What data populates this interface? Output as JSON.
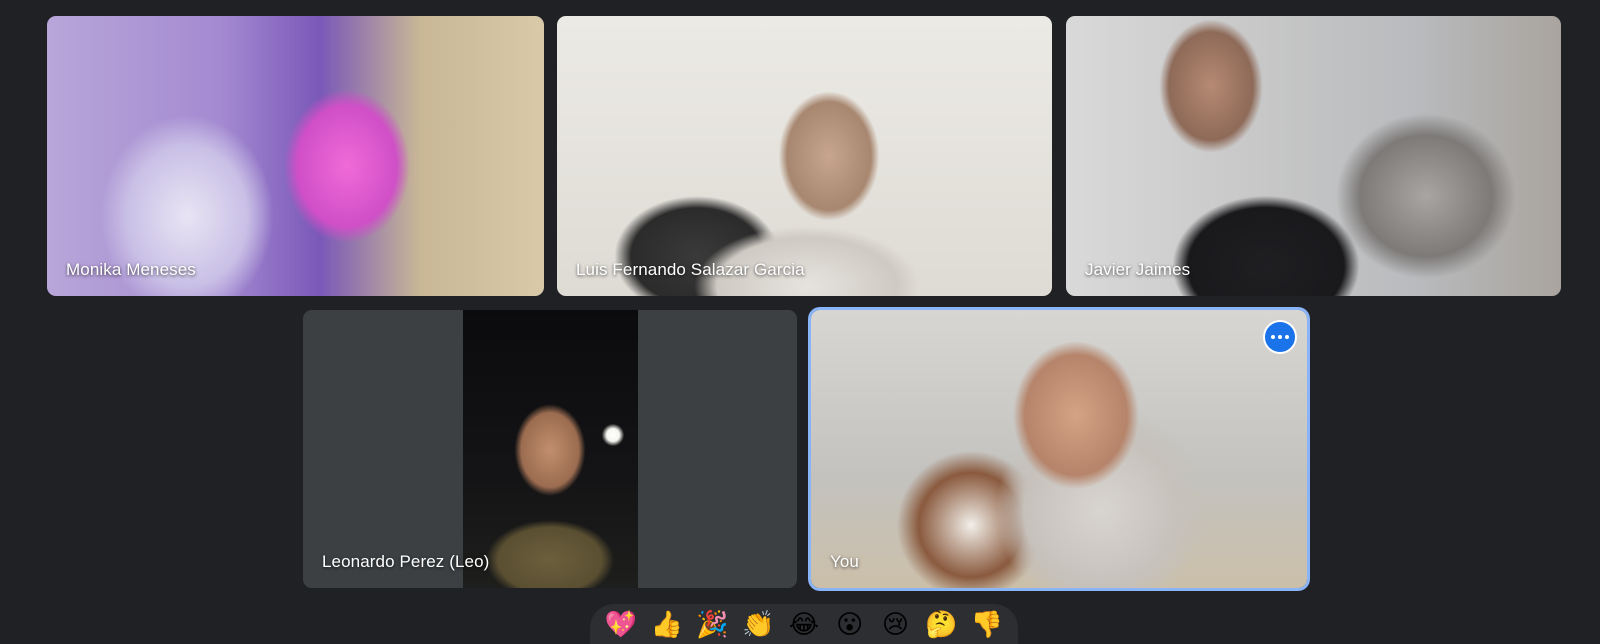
{
  "participants": [
    {
      "name": "Monika Meneses"
    },
    {
      "name": "Luis Fernando Salazar Garcia"
    },
    {
      "name": "Javier Jaimes"
    },
    {
      "name": "Leonardo Perez (Leo)"
    },
    {
      "name": "You",
      "active_speaker": true,
      "highlight_color": "#8ab4f8",
      "more_button_color": "#1a73e8"
    }
  ],
  "reactions": [
    {
      "emoji": "💖",
      "icon": "sparkling-heart-icon"
    },
    {
      "emoji": "👍",
      "icon": "thumbs-up-icon"
    },
    {
      "emoji": "🎉",
      "icon": "party-popper-icon"
    },
    {
      "emoji": "👏",
      "icon": "clapping-hands-icon"
    },
    {
      "emoji": "😂",
      "icon": "tears-of-joy-icon"
    },
    {
      "emoji": "😮",
      "icon": "surprised-face-icon"
    },
    {
      "emoji": "😢",
      "icon": "crying-face-icon"
    },
    {
      "emoji": "🤔",
      "icon": "thinking-face-icon"
    },
    {
      "emoji": "👎",
      "icon": "thumbs-down-icon"
    }
  ],
  "colors": {
    "background": "#202124",
    "tile_background": "#3c4043",
    "reaction_bar": "#2d2e31"
  }
}
